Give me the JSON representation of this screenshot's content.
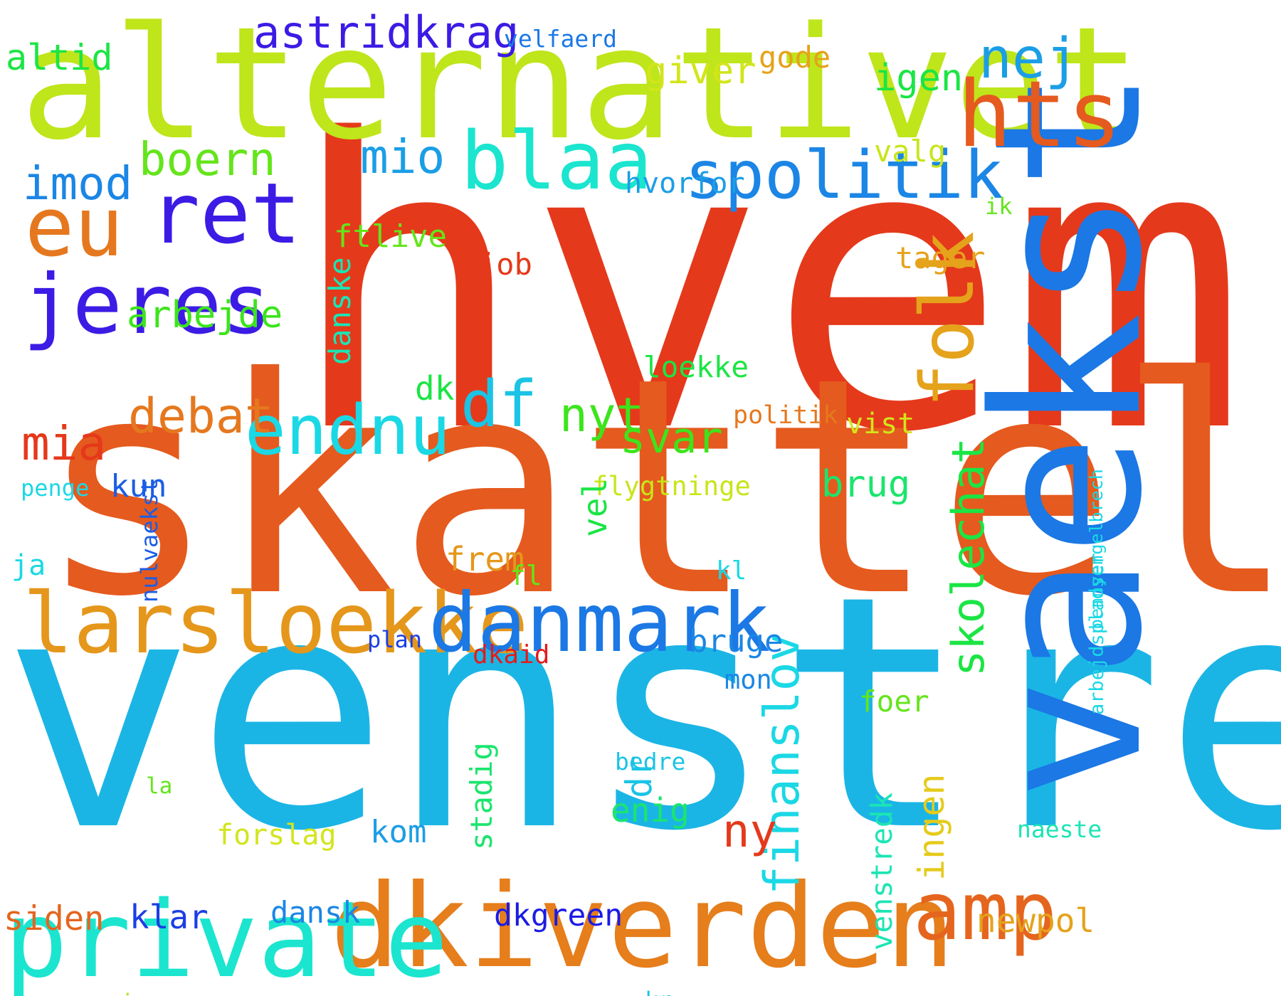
{
  "words": [
    {
      "id": "hvem",
      "text": "hvem",
      "color": "#e5391b"
    },
    {
      "id": "skattely",
      "text": "skattely",
      "color": "#e55a1e"
    },
    {
      "id": "venstre",
      "text": "venstre",
      "color": "#1bb5e5"
    },
    {
      "id": "alternativet",
      "text": "alternativet",
      "color": "#bfe51b"
    },
    {
      "id": "vaekst",
      "text": "vaekst",
      "color": "#1b78e5"
    },
    {
      "id": "dkiverden",
      "text": "dkiverden",
      "color": "#e57e1b"
    },
    {
      "id": "private",
      "text": "private",
      "color": "#1be5cf"
    },
    {
      "id": "larsloekke",
      "text": "larsloekke",
      "color": "#e5971b"
    },
    {
      "id": "danmark",
      "text": "danmark",
      "color": "#1b78e5"
    },
    {
      "id": "hts",
      "text": "hts",
      "color": "#e55a1e"
    },
    {
      "id": "ret",
      "text": "ret",
      "color": "#3c1be5"
    },
    {
      "id": "jeres",
      "text": "jeres",
      "color": "#3c1be5"
    },
    {
      "id": "eu",
      "text": "eu",
      "color": "#e5781e"
    },
    {
      "id": "blaa",
      "text": "blaa",
      "color": "#1be5cf"
    },
    {
      "id": "spolitik",
      "text": "spolitik",
      "color": "#1b86e5"
    },
    {
      "id": "amp",
      "text": "amp",
      "color": "#e5651e"
    },
    {
      "id": "folk",
      "text": "folk",
      "color": "#e5a21b"
    },
    {
      "id": "endnu",
      "text": "endnu",
      "color": "#1bd8e5"
    },
    {
      "id": "df",
      "text": "df",
      "color": "#1bc4e5"
    },
    {
      "id": "nej",
      "text": "nej",
      "color": "#1b9ee5"
    },
    {
      "id": "astridkrag",
      "text": "astridkrag",
      "color": "#3c1be5"
    },
    {
      "id": "boern",
      "text": "boern",
      "color": "#64e51b"
    },
    {
      "id": "imod",
      "text": "imod",
      "color": "#1b86e5"
    },
    {
      "id": "mio",
      "text": "mio",
      "color": "#1b9ee5"
    },
    {
      "id": "debat",
      "text": "debat",
      "color": "#e5781e"
    },
    {
      "id": "mia",
      "text": "mia",
      "color": "#e5391b"
    },
    {
      "id": "nyt",
      "text": "nyt",
      "color": "#3ce51b"
    },
    {
      "id": "svar",
      "text": "svar",
      "color": "#3ce51b"
    },
    {
      "id": "skolechat",
      "text": "skolechat",
      "color": "#1be544"
    },
    {
      "id": "finanslov",
      "text": "finanslov",
      "color": "#1bd8e5"
    },
    {
      "id": "arbejde",
      "text": "arbejde",
      "color": "#3ce51b"
    },
    {
      "id": "altid",
      "text": "altid",
      "color": "#1be544"
    },
    {
      "id": "velfaerd",
      "text": "velfaerd",
      "color": "#1b78e5"
    },
    {
      "id": "giver",
      "text": "giver",
      "color": "#d2e51b"
    },
    {
      "id": "gode",
      "text": "gode",
      "color": "#e5a21b"
    },
    {
      "id": "igen",
      "text": "igen",
      "color": "#1be544"
    },
    {
      "id": "valg",
      "text": "valg",
      "color": "#c8e51b"
    },
    {
      "id": "hvorfor",
      "text": "hvorfor",
      "color": "#1b9ee5"
    },
    {
      "id": "ftlive",
      "text": "ftlive",
      "color": "#64e51b"
    },
    {
      "id": "ik",
      "text": "ik",
      "color": "#64e51b"
    },
    {
      "id": "job",
      "text": "job",
      "color": "#e5391b"
    },
    {
      "id": "tager",
      "text": "tager",
      "color": "#e5a21b"
    },
    {
      "id": "danske",
      "text": "danske",
      "color": "#1be5b4"
    },
    {
      "id": "dk",
      "text": "dk",
      "color": "#1be544"
    },
    {
      "id": "loekke",
      "text": "loekke",
      "color": "#1be544"
    },
    {
      "id": "politik",
      "text": "politik",
      "color": "#e5781e"
    },
    {
      "id": "vist",
      "text": "vist",
      "color": "#d2e51b"
    },
    {
      "id": "kun",
      "text": "kun",
      "color": "#1b5ee5"
    },
    {
      "id": "brug",
      "text": "brug",
      "color": "#1be56e"
    },
    {
      "id": "flygtninge",
      "text": "flygtninge",
      "color": "#c8e51b"
    },
    {
      "id": "penge",
      "text": "penge",
      "color": "#1bd8e5"
    },
    {
      "id": "nulvaekst",
      "text": "nulvaekst",
      "color": "#1b5ee5"
    },
    {
      "id": "frem",
      "text": "frem",
      "color": "#e5971b"
    },
    {
      "id": "vel",
      "text": "vel",
      "color": "#1be544"
    },
    {
      "id": "fl",
      "text": "fl",
      "color": "#64e51b"
    },
    {
      "id": "ja",
      "text": "ja",
      "color": "#1bd8e5"
    },
    {
      "id": "kl",
      "text": "kl",
      "color": "#1bd8e5"
    },
    {
      "id": "plan",
      "text": "plan",
      "color": "#1b3fe5"
    },
    {
      "id": "dkaid",
      "text": "dkaid",
      "color": "#e51b1b"
    },
    {
      "id": "bruge",
      "text": "bruge",
      "color": "#1b86e5"
    },
    {
      "id": "mon",
      "text": "mon",
      "color": "#1b86e5"
    },
    {
      "id": "foer",
      "text": "foer",
      "color": "#64e51b"
    },
    {
      "id": "dr",
      "text": "dr",
      "color": "#1bc4e5"
    },
    {
      "id": "enig",
      "text": "enig",
      "color": "#1be56e"
    },
    {
      "id": "ny",
      "text": "ny",
      "color": "#e5391b"
    },
    {
      "id": "bedre",
      "text": "bedre",
      "color": "#1bc4e5"
    },
    {
      "id": "la",
      "text": "la",
      "color": "#64e51b"
    },
    {
      "id": "stadig",
      "text": "stadig",
      "color": "#1be56e"
    },
    {
      "id": "forslag",
      "text": "forslag",
      "color": "#d2e51b"
    },
    {
      "id": "kom",
      "text": "kom",
      "color": "#1b9ee5"
    },
    {
      "id": "ingen",
      "text": "ingen",
      "color": "#e5cb1b"
    },
    {
      "id": "venstredk",
      "text": "venstredk",
      "color": "#1be5b4"
    },
    {
      "id": "naeste",
      "text": "naeste",
      "color": "#1be5b4"
    },
    {
      "id": "siden",
      "text": "siden",
      "color": "#e5651e"
    },
    {
      "id": "klar",
      "text": "klar",
      "color": "#1b3fe5"
    },
    {
      "id": "dansk",
      "text": "dansk",
      "color": "#1b86e5"
    },
    {
      "id": "dkgreen",
      "text": "dkgreen",
      "color": "#1b1be5"
    },
    {
      "id": "newpol",
      "text": "newpol",
      "color": "#e5a21b"
    },
    {
      "id": "regeringen",
      "text": "regeringen",
      "color": "#a8e51b"
    },
    {
      "id": "kr",
      "text": "kr",
      "color": "#1bc4e5"
    },
    {
      "id": "bennyengelbrech",
      "text": "bennyengelbrech",
      "color": "#1bd8e5"
    },
    {
      "id": "arbejdspladser",
      "text": "arbejdspladser",
      "color": "#1bd8e5"
    }
  ]
}
